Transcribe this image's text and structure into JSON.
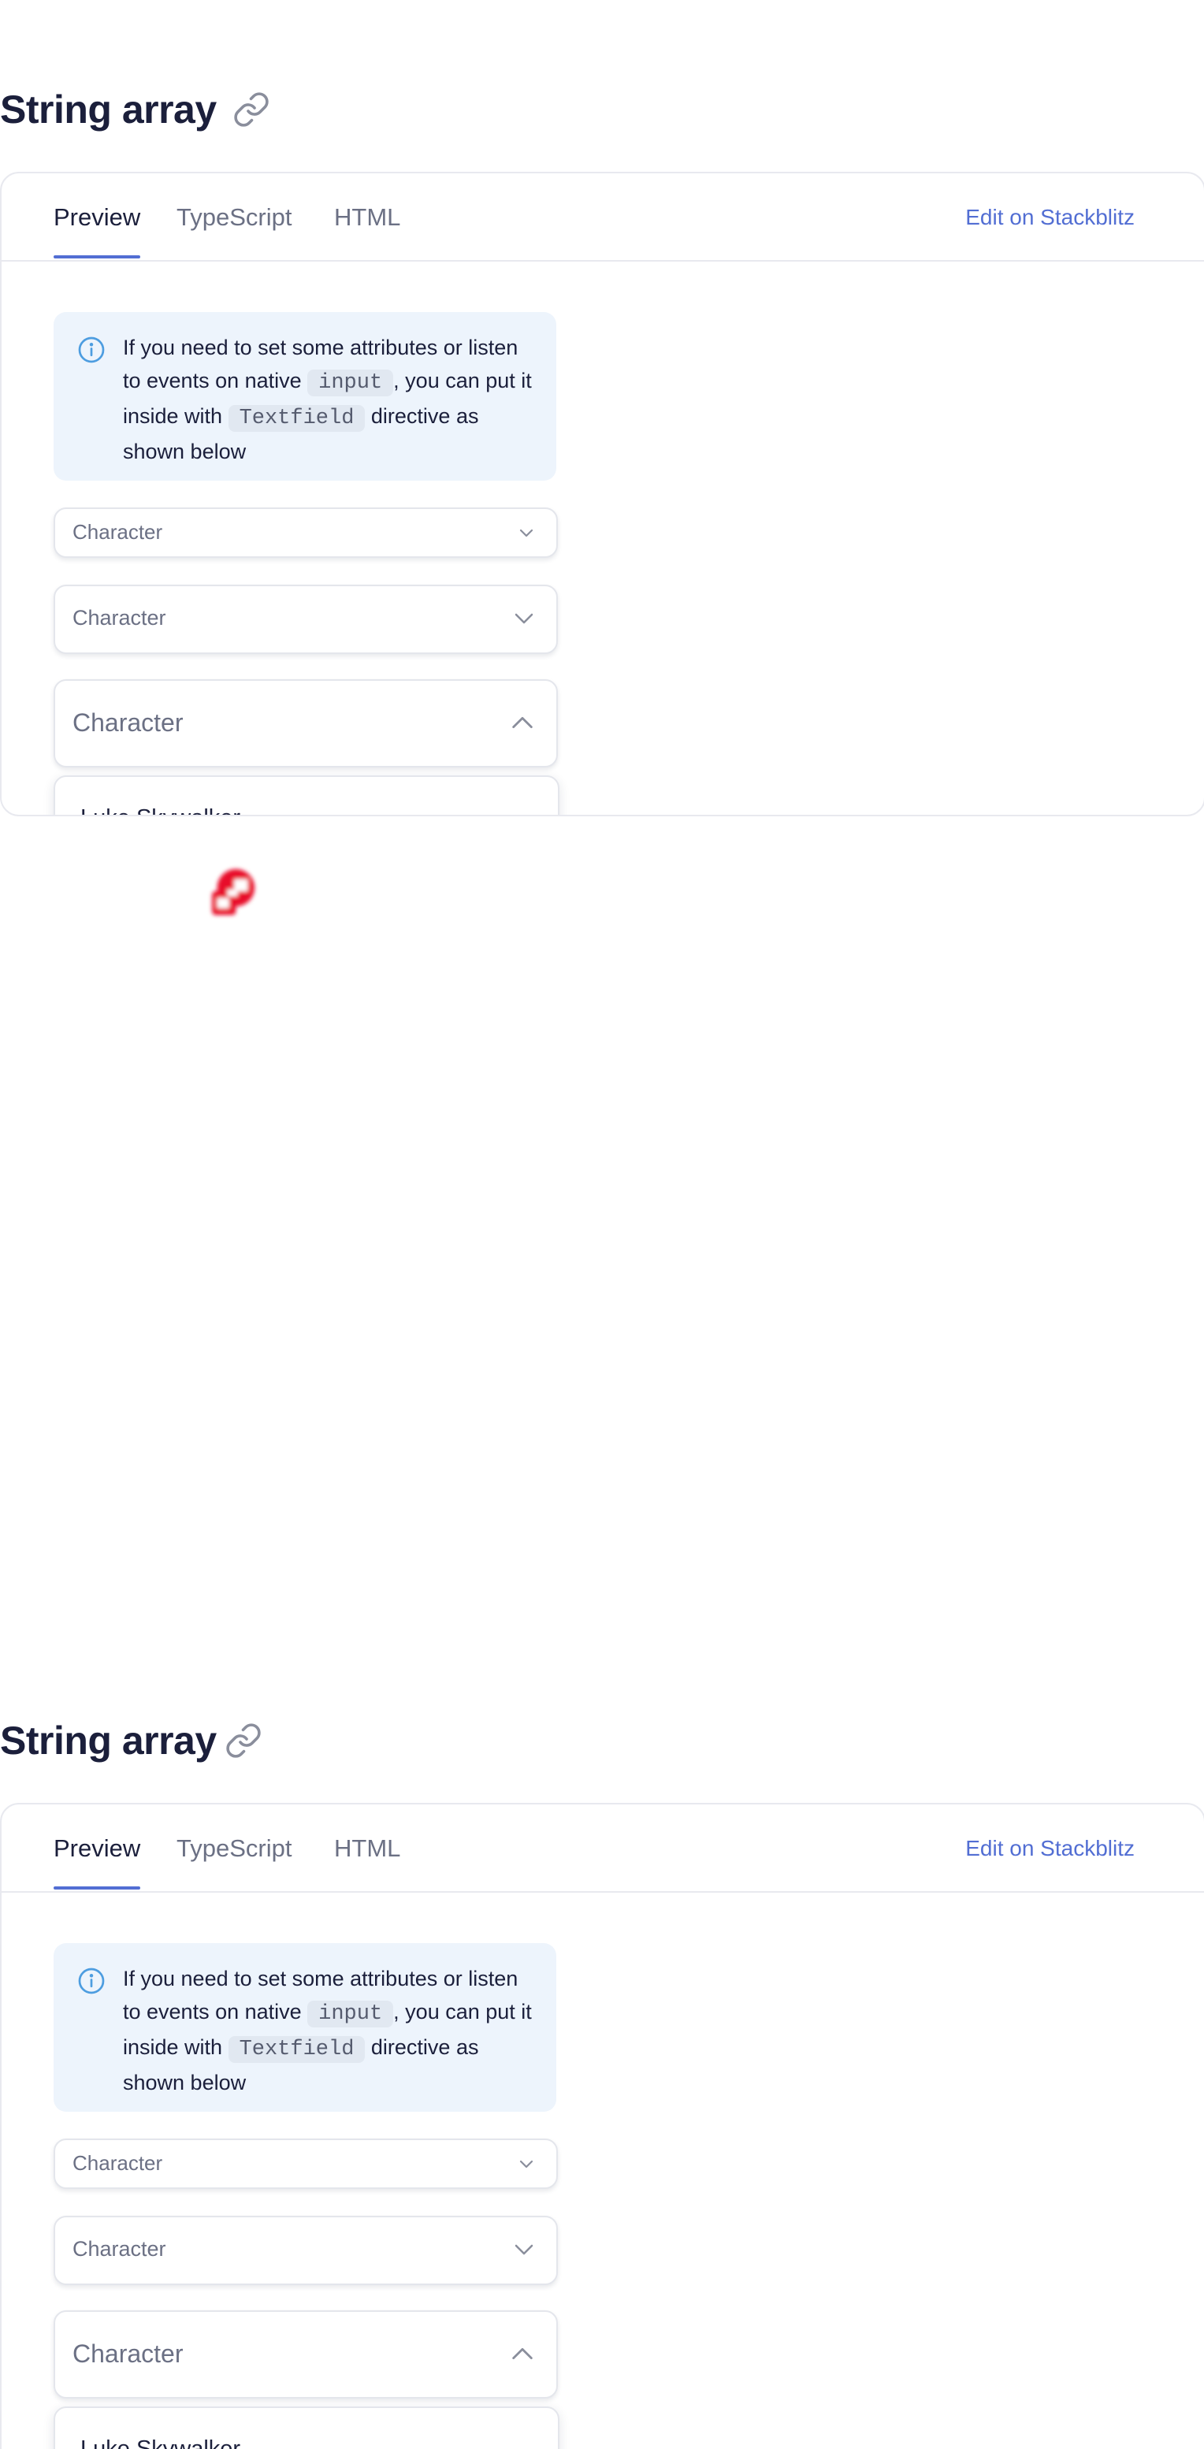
{
  "sections": [
    {
      "heading": "String array",
      "tabs": [
        "Preview",
        "TypeScript",
        "HTML"
      ],
      "active_tab": "Preview",
      "edit_link": "Edit on Stackblitz",
      "notice": {
        "icon": "info-icon",
        "text_1": "If you need to set some attributes or listen to events on native ",
        "code_1": "input",
        "text_2": ", you can put it inside with ",
        "code_2": "Textfield",
        "text_3": " directive as shown below"
      },
      "selects": [
        "Character",
        "Character",
        "Character"
      ],
      "dropdown_option": "Luke Skywalker"
    },
    {
      "heading": "String array",
      "tabs": [
        "Preview",
        "TypeScript",
        "HTML"
      ],
      "active_tab": "Preview",
      "edit_link": "Edit on Stackblitz",
      "notice": {
        "icon": "info-icon",
        "text_1": "If you need to set some attributes or listen to events on native ",
        "code_1": "input",
        "text_2": ", you can put it inside with ",
        "code_2": "Textfield",
        "text_3": " directive as shown below"
      },
      "selects": [
        "Character",
        "Character",
        "Character"
      ],
      "dropdown_option": "Luke Skywalker"
    }
  ],
  "colors": {
    "accent": "#526ed3",
    "notice_bg": "#edf4fc",
    "text": "#1b1f3b",
    "muted": "#6b7084",
    "cursor": "#e8102a"
  },
  "cursor_icon": "cursor-icon"
}
